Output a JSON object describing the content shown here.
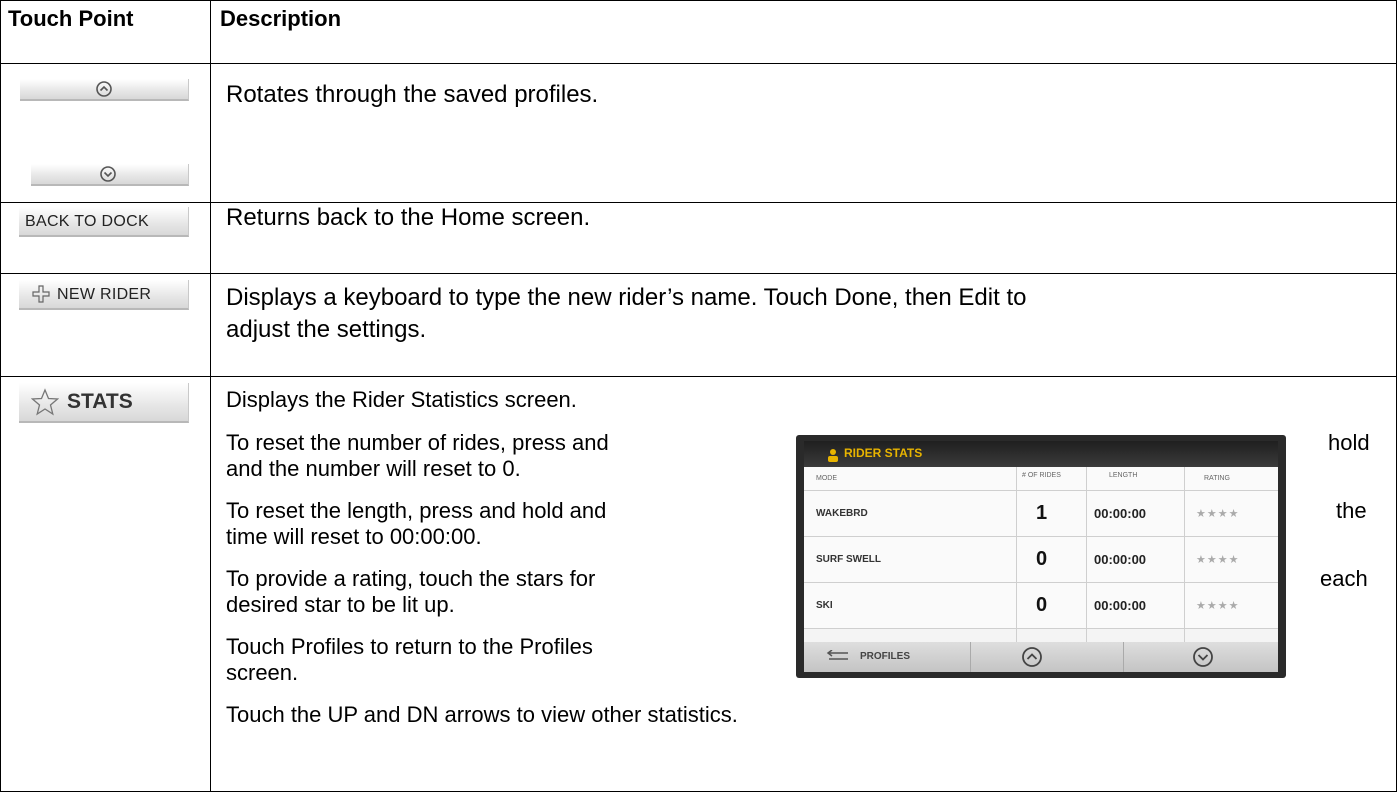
{
  "table": {
    "header": {
      "touch_point": "Touch Point",
      "description": "Description"
    },
    "rows": [
      {
        "description": "Rotates through the saved profiles."
      },
      {
        "touch_label": "BACK TO DOCK",
        "description": "Returns back to the Home screen."
      },
      {
        "touch_label": "NEW RIDER",
        "description_line1": "Displays a keyboard to type the new rider’s name.  Touch Done, then Edit to",
        "description_line2": "adjust the settings."
      },
      {
        "touch_label": "STATS",
        "lines": [
          "Displays the Rider Statistics screen.",
          "To reset the number of rides, press and",
          "and the number will reset to 0.",
          "To reset the length, press and hold and",
          "time will reset to 00:00:00.",
          "To provide a rating, touch the stars for",
          "desired star to be lit up.",
          "Touch Profiles to return to the Profiles",
          "screen.",
          "Touch the UP and DN arrows to view other statistics."
        ],
        "right_words": [
          "hold",
          "the",
          "each"
        ]
      }
    ]
  },
  "stats_screen": {
    "title": "RIDER STATS",
    "col_headers": [
      "MODE",
      "# OF RIDES",
      "LENGTH",
      "RATING"
    ],
    "rows": [
      {
        "name": "WAKEBRD",
        "rides": "1",
        "length": "00:00:00",
        "stars": "★★★★"
      },
      {
        "name": "SURF SWELL",
        "rides": "0",
        "length": "00:00:00",
        "stars": "★★★★"
      },
      {
        "name": "SKI",
        "rides": "0",
        "length": "00:00:00",
        "stars": "★★★★"
      }
    ],
    "footer_profiles": "PROFILES"
  },
  "icons": [
    "chevron-up-circle-icon",
    "chevron-down-circle-icon",
    "plus-icon",
    "star-outline-icon",
    "back-arrow-icon",
    "user-icon"
  ],
  "colors": {
    "border": "#000000",
    "screen_title": "#e8b400"
  }
}
